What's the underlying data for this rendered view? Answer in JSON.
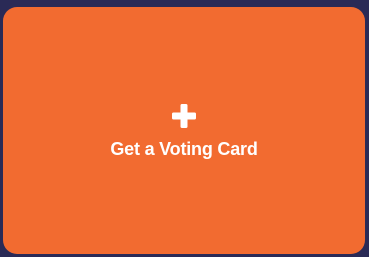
{
  "card": {
    "label": "Get a Voting Card",
    "icon": "plus-icon",
    "background_color": "#f26b30",
    "text_color": "#ffffff"
  },
  "page": {
    "background_color": "#2a2a56"
  }
}
